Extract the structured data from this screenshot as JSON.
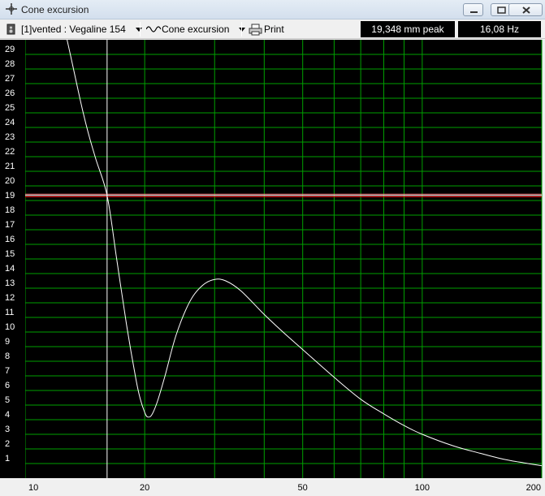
{
  "window": {
    "title": "Cone excursion"
  },
  "toolbar": {
    "system_label": "[1]vented : Vegaline 154",
    "graph_label": "Cone excursion",
    "print_label": "Print",
    "readout_value": "19,348 mm peak",
    "readout_freq": "16,08 Hz"
  },
  "colors": {
    "plot_background": "#000000",
    "grid": "#00a000",
    "curve": "#ffffff",
    "cursor": "#ffffff",
    "marker_line_top": "#ff8080",
    "marker_line_bottom": "#ff0000"
  },
  "chart_data": {
    "type": "line",
    "x_scale": "log",
    "xlim": [
      10,
      200
    ],
    "ylim": [
      0,
      30
    ],
    "x_tick_labels": [
      "10",
      "20",
      "50",
      "100",
      "200"
    ],
    "x_ticks": [
      10,
      20,
      50,
      100,
      200
    ],
    "x_grid": [
      10,
      20,
      30,
      40,
      50,
      60,
      70,
      80,
      90,
      100,
      200
    ],
    "y_tick_labels": [
      "1",
      "2",
      "3",
      "4",
      "5",
      "6",
      "7",
      "8",
      "9",
      "10",
      "11",
      "12",
      "13",
      "14",
      "15",
      "16",
      "17",
      "18",
      "19",
      "20",
      "21",
      "22",
      "23",
      "24",
      "25",
      "26",
      "27",
      "28",
      "29"
    ],
    "grid": true,
    "cursor": {
      "x": 16.08,
      "y": 19.348
    },
    "series": [
      {
        "x": [
          10,
          12,
          14,
          15,
          16.08,
          17,
          18,
          19,
          19.5,
          20,
          20.3,
          20.8,
          21.5,
          22.5,
          24,
          26,
          28,
          30,
          32,
          35,
          40,
          45,
          50,
          60,
          70,
          80,
          90,
          100,
          120,
          140,
          160,
          180,
          200
        ],
        "y": [
          40,
          33,
          25,
          22,
          19.348,
          15,
          10.5,
          6.8,
          5.4,
          4.5,
          4.2,
          4.3,
          5.2,
          7.0,
          9.8,
          12.1,
          13.2,
          13.6,
          13.5,
          12.8,
          11.2,
          9.9,
          8.8,
          6.9,
          5.4,
          4.4,
          3.6,
          3.0,
          2.2,
          1.7,
          1.3,
          1.05,
          0.85
        ]
      }
    ]
  }
}
